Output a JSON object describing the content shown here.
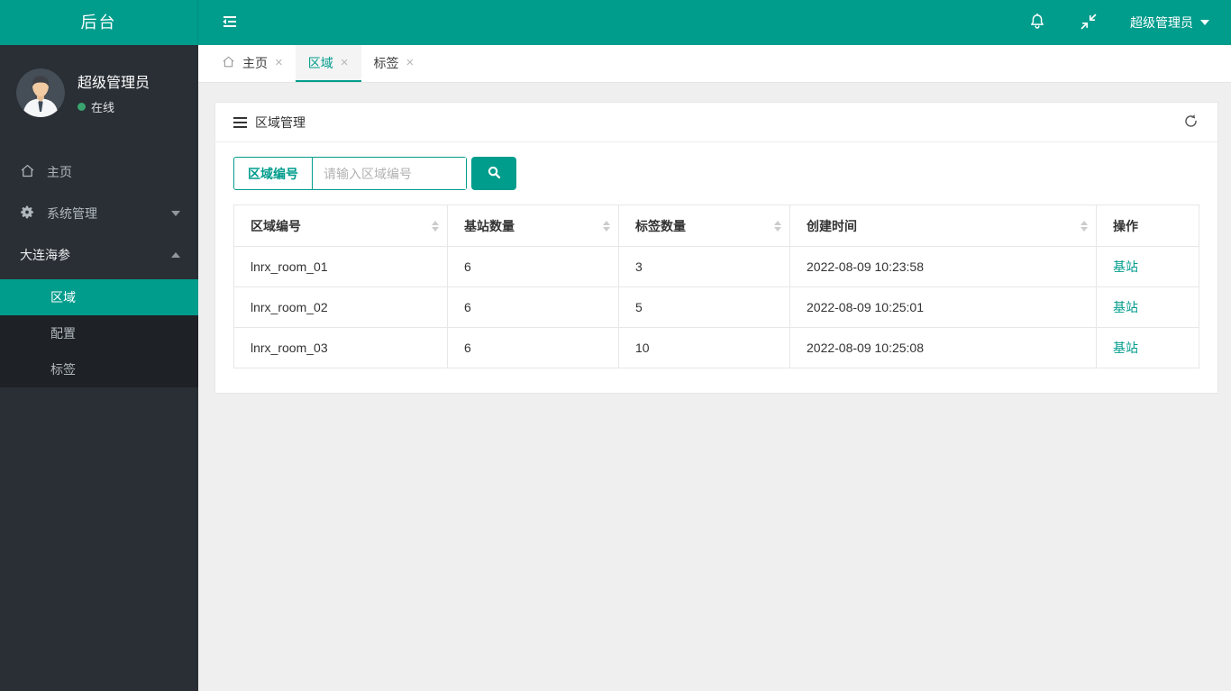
{
  "colors": {
    "accent": "#009c8c",
    "sidebar_bg": "#2a2f35",
    "submenu_bg": "#1e2226",
    "online_green": "#3aa46f",
    "body_bg": "#efefef",
    "table_border": "#e7e7e7"
  },
  "topbar": {
    "logo": "后台",
    "user_menu": "超级管理员"
  },
  "sidebar": {
    "user": {
      "name": "超级管理员",
      "status": "在线"
    },
    "items": [
      {
        "label": "主页",
        "icon": "home-icon"
      },
      {
        "label": "系统管理",
        "icon": "gear-icon",
        "caret": "down"
      },
      {
        "label": "大连海参",
        "caret": "up"
      }
    ],
    "submenu": [
      {
        "label": "区域",
        "active": true
      },
      {
        "label": "配置",
        "active": false
      },
      {
        "label": "标签",
        "active": false
      }
    ]
  },
  "tabs": [
    {
      "label": "主页",
      "icon": "home-icon",
      "active": false
    },
    {
      "label": "区域",
      "active": true
    },
    {
      "label": "标签",
      "active": false
    }
  ],
  "glyphs": {
    "close": "×"
  },
  "panel": {
    "title": "区域管理",
    "search": {
      "label": "区域编号",
      "placeholder": "请输入区域编号"
    }
  },
  "table": {
    "columns": [
      {
        "label": "区域编号",
        "sortable": true
      },
      {
        "label": "基站数量",
        "sortable": true
      },
      {
        "label": "标签数量",
        "sortable": true
      },
      {
        "label": "创建时间",
        "sortable": true
      },
      {
        "label": "操作",
        "sortable": false
      }
    ],
    "rows": [
      {
        "area_id": "lnrx_room_01",
        "base_stations": "6",
        "tags": "3",
        "created_at": "2022-08-09 10:23:58",
        "action": "基站"
      },
      {
        "area_id": "lnrx_room_02",
        "base_stations": "6",
        "tags": "5",
        "created_at": "2022-08-09 10:25:01",
        "action": "基站"
      },
      {
        "area_id": "lnrx_room_03",
        "base_stations": "6",
        "tags": "10",
        "created_at": "2022-08-09 10:25:08",
        "action": "基站"
      }
    ]
  }
}
